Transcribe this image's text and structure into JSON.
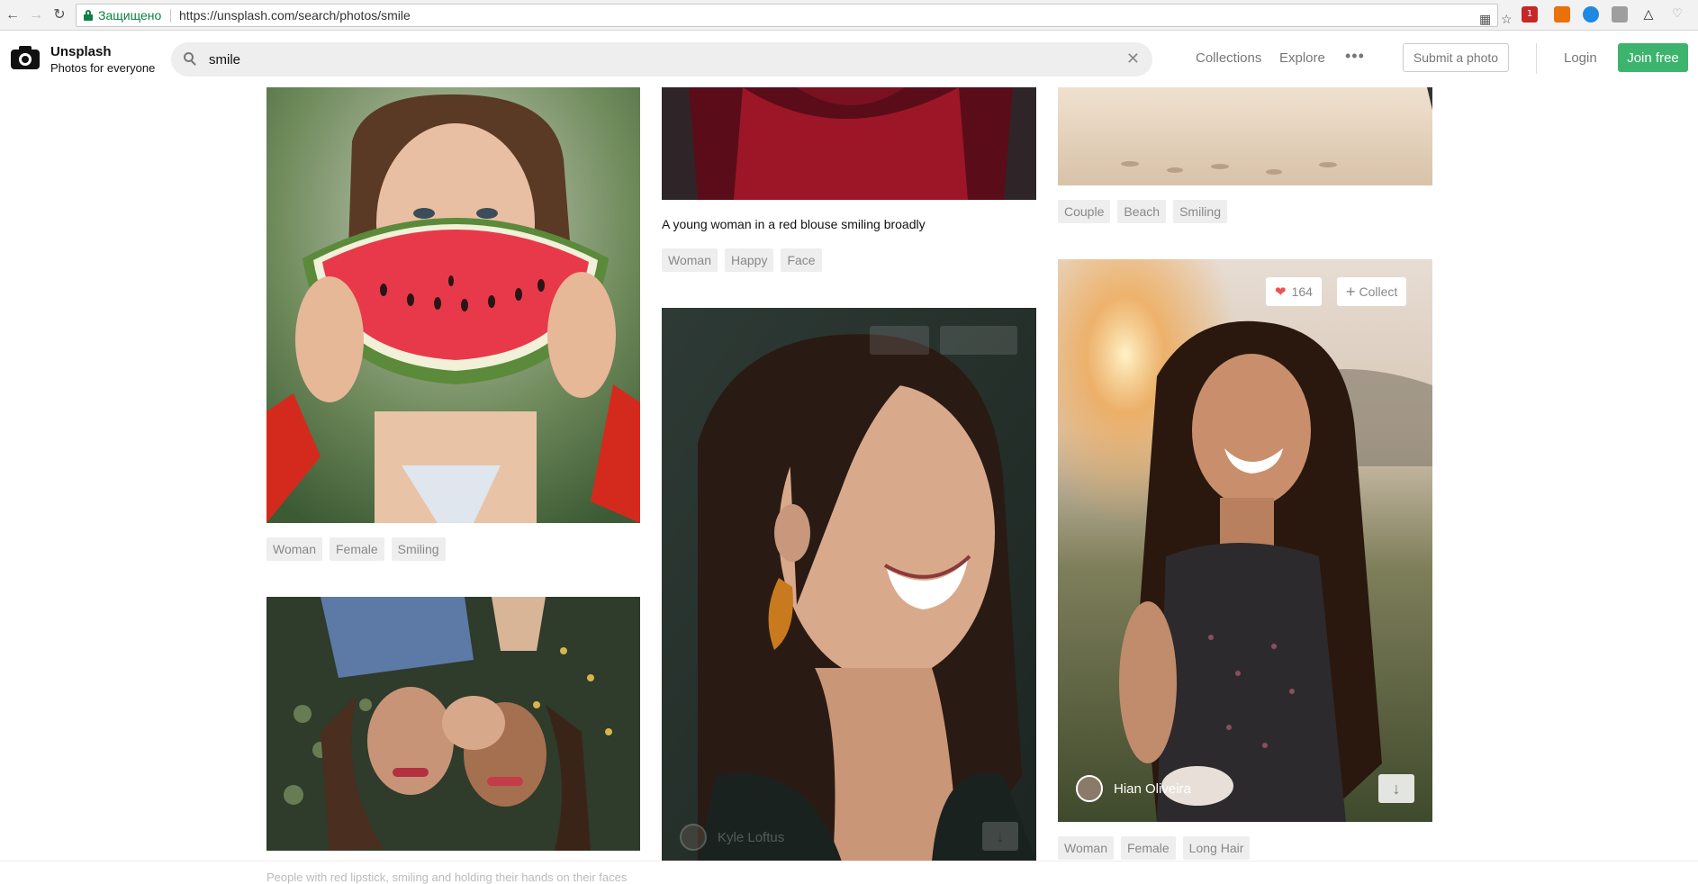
{
  "browser": {
    "secure_label": "Защищено",
    "url": "https://unsplash.com/search/photos/smile",
    "ext_badge": "1"
  },
  "header": {
    "brand": "Unsplash",
    "tagline": "Photos for everyone",
    "search_value": "smile",
    "nav": [
      "Collections",
      "Explore"
    ],
    "more": "•••",
    "submit_label": "Submit a photo",
    "login_label": "Login",
    "join_label": "Join free",
    "join_color": "#3cb46e"
  },
  "columns": {
    "left": {
      "photo1_tags": [
        "Woman",
        "Female",
        "Smiling"
      ],
      "photo2_caption_partial": "People with red lipstick, smiling and holding their hands on their faces"
    },
    "middle": {
      "photo1_caption": "A young woman in a red blouse smiling broadly",
      "photo1_tags": [
        "Woman",
        "Happy",
        "Face"
      ],
      "photo2_author": "Kyle Loftus"
    },
    "right": {
      "photo1_tags": [
        "Couple",
        "Beach",
        "Smiling"
      ],
      "photo2_likes": "164",
      "photo2_collect": "Collect",
      "photo2_author": "Hian Oliveira",
      "photo2_tags": [
        "Woman",
        "Female",
        "Long Hair"
      ]
    }
  }
}
